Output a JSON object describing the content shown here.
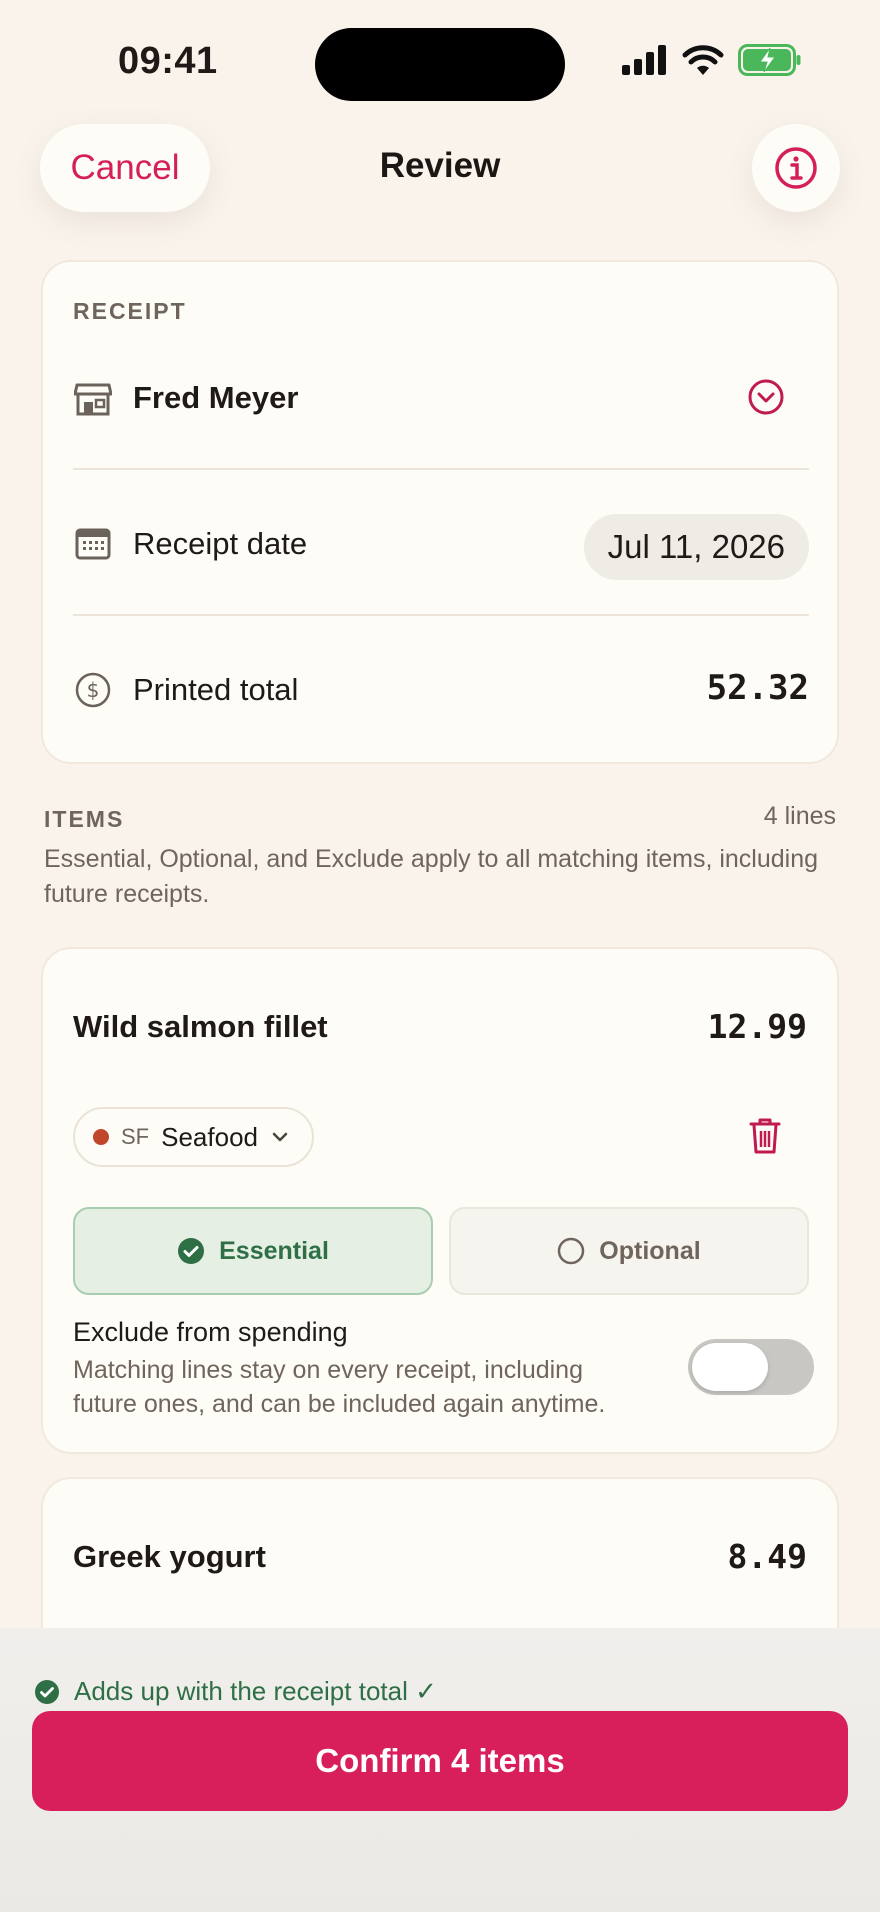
{
  "status_bar": {
    "time": "09:41"
  },
  "nav": {
    "cancel_label": "Cancel",
    "title": "Review",
    "info_icon": "info-icon"
  },
  "receipt": {
    "section_label": "RECEIPT",
    "store_name": "Fred Meyer",
    "date_label": "Receipt date",
    "date_value": "Jul 11, 2026",
    "total_label": "Printed total",
    "total_value": "52.32"
  },
  "items": {
    "section_label": "ITEMS",
    "lines_count": "4 lines",
    "note": "Essential, Optional, and Exclude apply to all matching items, including future receipts.",
    "list": [
      {
        "name": "Wild salmon fillet",
        "price": "12.99",
        "category_code": "SF",
        "category_name": "Seafood",
        "category_color": "#c0462c",
        "essential_label": "Essential",
        "optional_label": "Optional",
        "selected": "Essential",
        "exclude_title": "Exclude from spending",
        "exclude_desc": "Matching lines stay on every receipt, including future ones, and can be included again anytime.",
        "exclude_on": false
      },
      {
        "name": "Greek yogurt",
        "price": "8.49"
      }
    ]
  },
  "footer": {
    "adds_up_text": "Adds up with the receipt total ✓",
    "confirm_label": "Confirm 4 items"
  },
  "colors": {
    "accent": "#d81f5b",
    "success": "#2f6f45",
    "background": "#f9f3ec"
  }
}
